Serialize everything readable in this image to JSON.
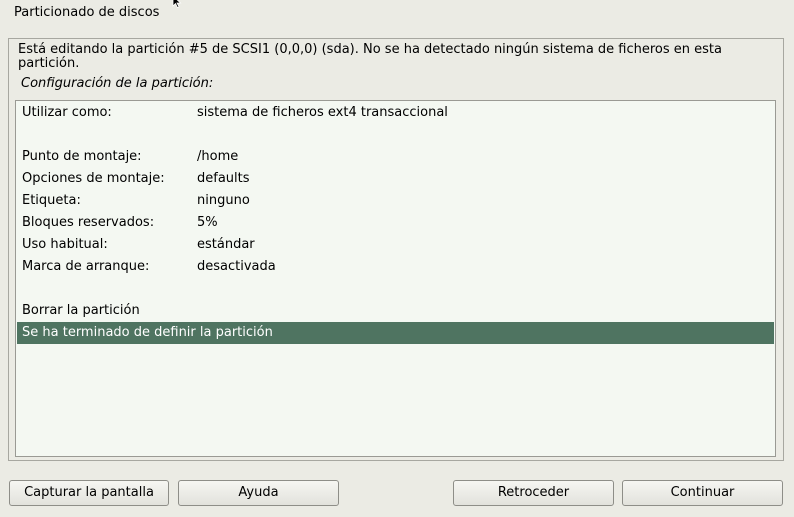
{
  "window": {
    "title": "Particionado de discos"
  },
  "info": {
    "message": "Está editando la partición #5 de SCSI1 (0,0,0) (sda). No se ha detectado ningún sistema de ficheros en esta partición.",
    "subtitle": "Configuración de la partición:"
  },
  "settings": [
    {
      "key": "Utilizar como:",
      "value": "sistema de ficheros ext4 transaccional"
    },
    {
      "key": "Punto de montaje:",
      "value": "/home"
    },
    {
      "key": "Opciones de montaje:",
      "value": "defaults"
    },
    {
      "key": "Etiqueta:",
      "value": "ninguno"
    },
    {
      "key": "Bloques reservados:",
      "value": "5%"
    },
    {
      "key": "Uso habitual:",
      "value": "estándar"
    },
    {
      "key": "Marca de arranque:",
      "value": "desactivada"
    }
  ],
  "actions": [
    {
      "label": "Borrar la partición",
      "selected": false
    },
    {
      "label": "Se ha terminado de definir la partición",
      "selected": true
    }
  ],
  "buttons": {
    "screenshot": "Capturar la pantalla",
    "help": "Ayuda",
    "back": "Retroceder",
    "continue": "Continuar"
  },
  "colors": {
    "selection": "#4f7461",
    "list_background": "#f4f8f2",
    "window_background": "#ebebe4"
  }
}
